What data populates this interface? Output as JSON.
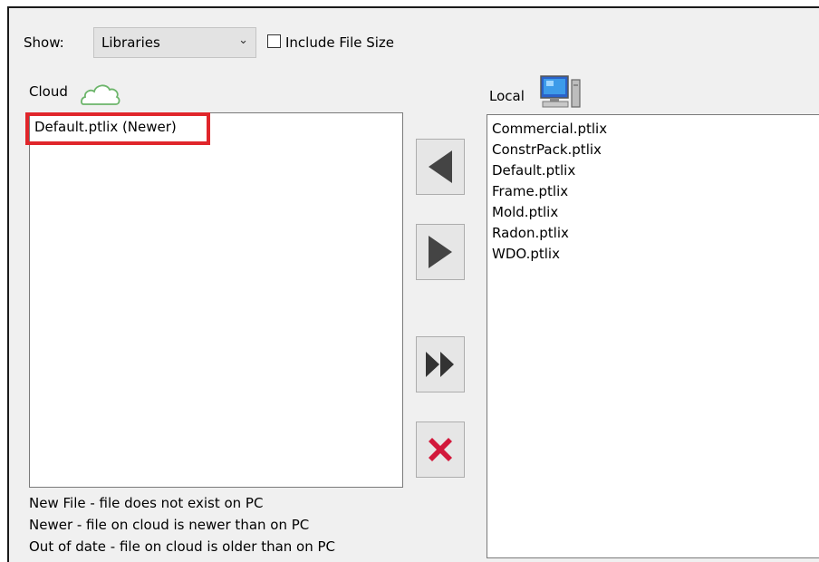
{
  "show": {
    "label": "Show:",
    "selected": "Libraries",
    "arrow_icon": "chevron-down-icon"
  },
  "include_file_size": {
    "label": "Include File Size",
    "checked": false
  },
  "cloud": {
    "label": "Cloud",
    "icon": "cloud-icon",
    "icon_color": "#6cb56a",
    "items": [
      "Default.ptlix (Newer)"
    ],
    "highlight_color": "#e0262b"
  },
  "local": {
    "label": "Local",
    "icon": "computer-icon",
    "items": [
      "Commercial.ptlix",
      "ConstrPack.ptlix",
      "Default.ptlix",
      "Frame.ptlix",
      "Mold.ptlix",
      "Radon.ptlix",
      "WDO.ptlix"
    ]
  },
  "buttons": {
    "download_icon": "triangle-left-icon",
    "upload_icon": "triangle-right-icon",
    "download_all_icon": "double-chevron-right-icon",
    "delete_icon": "red-x-icon",
    "delete_color": "#d2183b"
  },
  "legend": [
    "New File - file does not exist on PC",
    "Newer - file on cloud is newer than on PC",
    "Out of date - file on cloud is older than on PC"
  ]
}
